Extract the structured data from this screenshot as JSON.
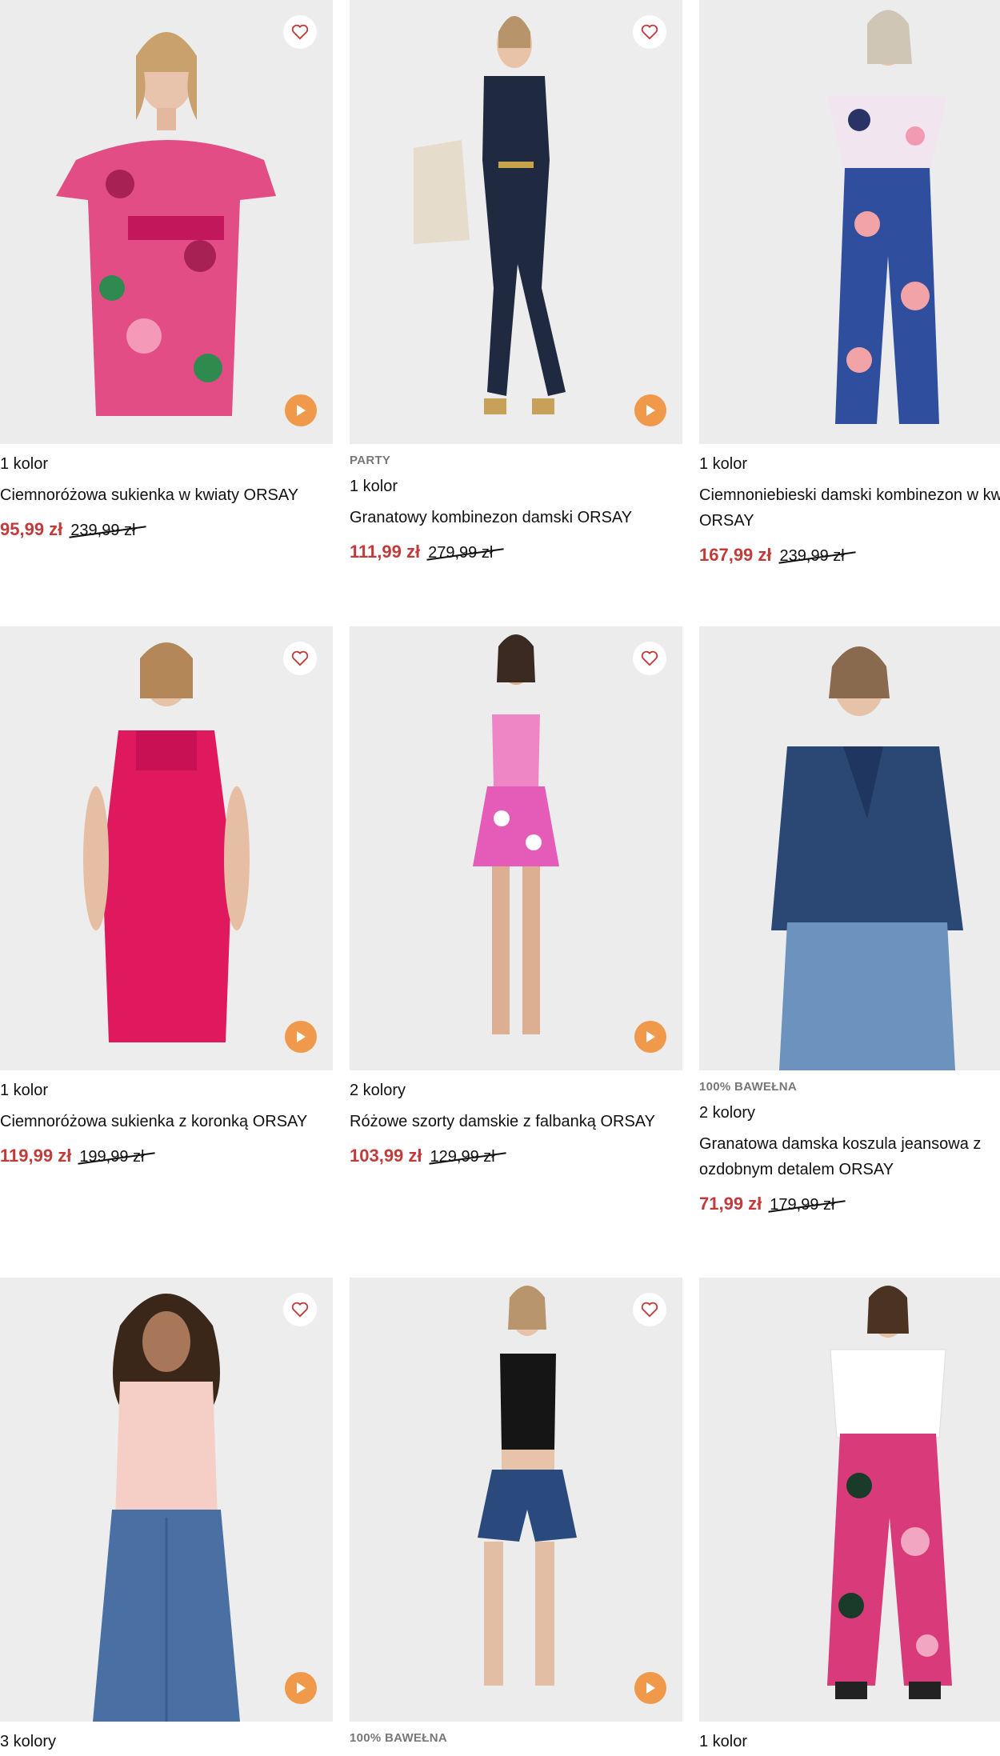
{
  "colors": {
    "sale_price": "#c23b3b",
    "play_button": "#f0994a",
    "heart": "#c23b3b",
    "image_bg": "#efefef"
  },
  "icons": {
    "favorite": "heart-outline-icon",
    "video": "play-icon"
  },
  "products": [
    {
      "badge": "",
      "colors_label": "1 kolor",
      "name": "Ciemnoróżowa sukienka w kwiaty ORSAY",
      "price_new": "95,99 zł",
      "price_old": "239,99 zł"
    },
    {
      "badge": "PARTY",
      "colors_label": "1 kolor",
      "name": "Granatowy kombinezon damski ORSAY",
      "price_new": "111,99 zł",
      "price_old": "279,99 zł"
    },
    {
      "badge": "",
      "colors_label": "1 kolor",
      "name": "Ciemnoniebieski damski kombinezon w kwiaty ORSAY",
      "price_new": "167,99 zł",
      "price_old": "239,99 zł"
    },
    {
      "badge": "",
      "colors_label": "1 kolor",
      "name": "Ciemnoróżowa sukienka z koronką ORSAY",
      "price_new": "119,99 zł",
      "price_old": "199,99 zł"
    },
    {
      "badge": "",
      "colors_label": "2 kolory",
      "name": "Różowe szorty damskie z falbanką ORSAY",
      "price_new": "103,99 zł",
      "price_old": "129,99 zł"
    },
    {
      "badge": "100% BAWEŁNA",
      "colors_label": "2 kolory",
      "name": "Granatowa damska koszula jeansowa z ozdobnym detalem ORSAY",
      "price_new": "71,99 zł",
      "price_old": "179,99 zł"
    },
    {
      "badge": "",
      "colors_label": "3 kolory",
      "name": "",
      "price_new": "",
      "price_old": ""
    },
    {
      "badge": "100% BAWEŁNA",
      "colors_label": "",
      "name": "",
      "price_new": "",
      "price_old": ""
    },
    {
      "badge": "",
      "colors_label": "1 kolor",
      "name": "",
      "price_new": "",
      "price_old": ""
    }
  ]
}
